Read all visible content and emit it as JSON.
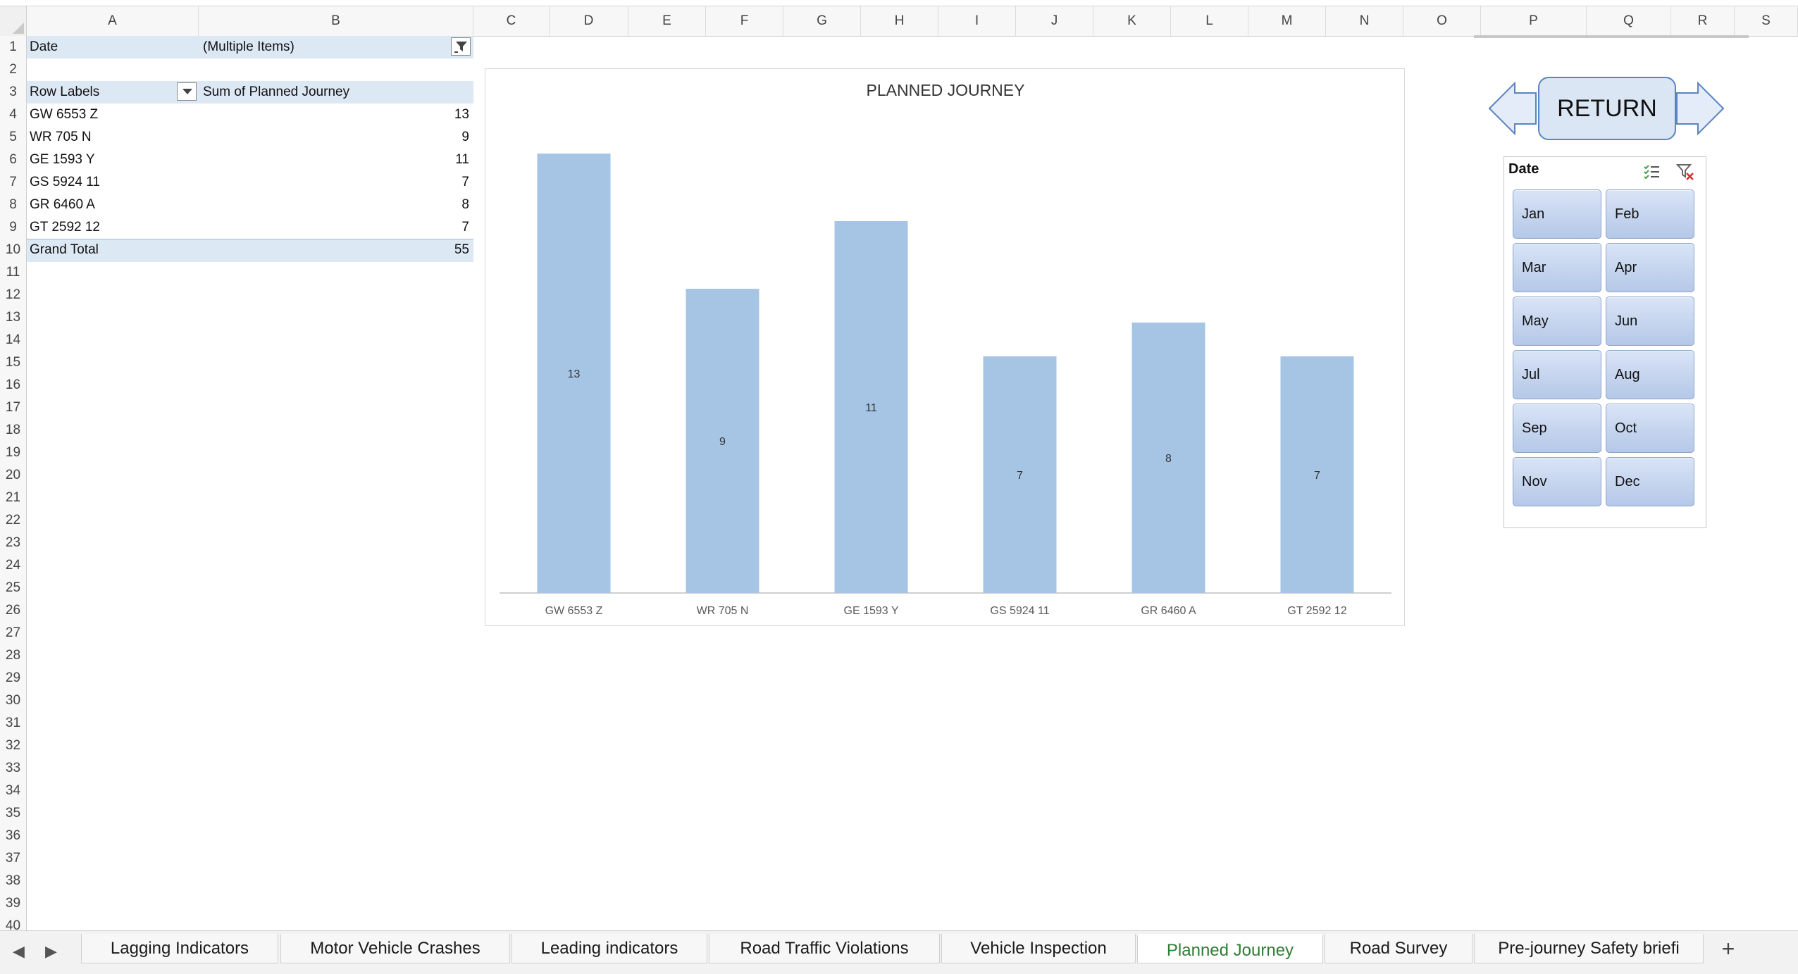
{
  "columns": [
    "A",
    "B",
    "C",
    "D",
    "E",
    "F",
    "G",
    "H",
    "I",
    "J",
    "K",
    "L",
    "M",
    "N",
    "O",
    "P",
    "Q",
    "R",
    "S"
  ],
  "rows": [
    "1",
    "2",
    "3",
    "4",
    "5",
    "6",
    "7",
    "8",
    "9",
    "10",
    "11",
    "12",
    "13",
    "14",
    "15",
    "16",
    "17",
    "18",
    "19",
    "20",
    "21",
    "22",
    "23",
    "24",
    "25",
    "26",
    "27",
    "28",
    "29",
    "30",
    "31",
    "32",
    "33",
    "34",
    "35",
    "36",
    "37",
    "38",
    "39",
    "40"
  ],
  "pivot": {
    "filter_label": "Date",
    "filter_value": "(Multiple Items)",
    "row_labels_header": "Row Labels",
    "sum_header": "Sum of Planned Journey",
    "rows": [
      {
        "label": "GW 6553 Z",
        "value": "13"
      },
      {
        "label": "WR 705 N",
        "value": "9"
      },
      {
        "label": "GE 1593 Y",
        "value": "11"
      },
      {
        "label": "GS 5924 11",
        "value": "7"
      },
      {
        "label": "GR 6460 A",
        "value": "8"
      },
      {
        "label": "GT 2592 12",
        "value": "7"
      }
    ],
    "grand_total_label": "Grand Total",
    "grand_total_value": "55"
  },
  "chart_data": {
    "type": "bar",
    "title": "PLANNED JOURNEY",
    "categories": [
      "GW 6553 Z",
      "WR 705 N",
      "GE 1593 Y",
      "GS 5924 11",
      "GR 6460 A",
      "GT 2592 12"
    ],
    "values": [
      13,
      9,
      11,
      7,
      8,
      7
    ],
    "ylim": [
      0,
      13
    ],
    "grid": false,
    "legend": "none",
    "bar_color": "#a6c4e4",
    "data_labels": true
  },
  "nav": {
    "return_label": "RETURN"
  },
  "slicer": {
    "title": "Date",
    "months": [
      "Jan",
      "Feb",
      "Mar",
      "Apr",
      "May",
      "Jun",
      "Jul",
      "Aug",
      "Sep",
      "Oct",
      "Nov",
      "Dec"
    ]
  },
  "tabs": [
    {
      "label": "Lagging Indicators",
      "active": false
    },
    {
      "label": "Motor Vehicle Crashes",
      "active": false
    },
    {
      "label": "Leading indicators",
      "active": false
    },
    {
      "label": "Road Traffic Violations",
      "active": false
    },
    {
      "label": "Vehicle Inspection",
      "active": false
    },
    {
      "label": "Planned Journey",
      "active": true
    },
    {
      "label": "Road Survey",
      "active": false
    },
    {
      "label": "Pre-journey Safety briefi",
      "active": false
    }
  ],
  "add_tab_label": "+",
  "colors": {
    "accent": "#2e7d32",
    "bar": "#a6c4e4",
    "band": "#dde8f5",
    "slicer_btn": "#c5d5ef"
  }
}
